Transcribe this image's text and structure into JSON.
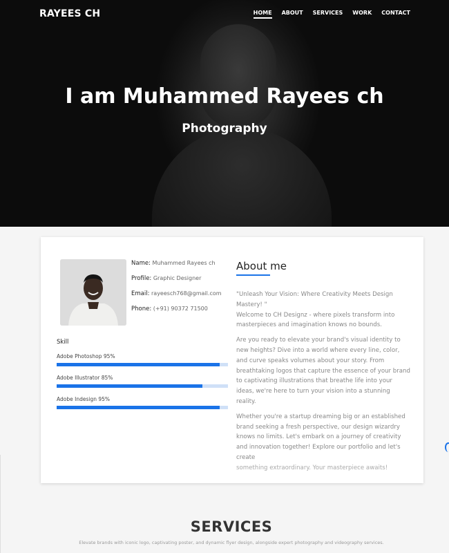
{
  "header": {
    "brand": "RAYEES CH",
    "nav": [
      "HOME",
      "ABOUT",
      "SERVICES",
      "WORK",
      "CONTACT"
    ],
    "active_nav": "HOME"
  },
  "hero": {
    "title": "I am Muhammed Rayees ch",
    "subtitle": "Photography"
  },
  "profile": {
    "name_label": "Name:",
    "name": "Muhammed Rayees ch",
    "profile_label": "Profile:",
    "profile": "Graphic Designer",
    "email_label": "Email:",
    "email": "rayeesch768@gmail.com",
    "phone_label": "Phone:",
    "phone": "(+91) 90372 71500"
  },
  "skills": {
    "title": "Skill",
    "items": [
      {
        "label": "Adobe Photoshop 95%",
        "percent": 95
      },
      {
        "label": "Adobe Illustrator 85%",
        "percent": 85
      },
      {
        "label": "Adobe Indesign 95%",
        "percent": 95
      }
    ]
  },
  "about": {
    "heading": "About me",
    "paragraphs": [
      "\"Unleash Your Vision: Where Creativity Meets Design Mastery! \"",
      "Welcome to CH Designz - where pixels transform into masterpieces and imagination knows no bounds.",
      "Are you ready to elevate your brand's visual identity to new heights? Dive into a world where every line, color, and curve speaks volumes about your story. From breathtaking logos that capture the essence of your brand to captivating illustrations that breathe life into your ideas, we're here to turn your vision into a stunning reality.",
      "Whether you're a startup dreaming big or an established brand seeking a fresh perspective, our design wizardry knows no limits. Let's embark on a journey of creativity and innovation together! Explore our portfolio and let's create",
      "something extraordinary. Your masterpiece awaits!"
    ]
  },
  "services": {
    "heading": "SERVICES",
    "description": "Elevate brands with iconic logo, captivating poster, and dynamic flyer design, alongside expert photography and videography services."
  },
  "colors": {
    "accent": "#1a73e8",
    "skill_track": "#cfe0f7",
    "hero_bg": "#141414"
  }
}
